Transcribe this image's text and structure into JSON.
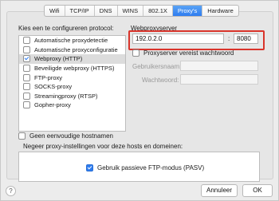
{
  "tabs": [
    "Wifi",
    "TCP/IP",
    "DNS",
    "WINS",
    "802.1X",
    "Proxy's",
    "Hardware"
  ],
  "active_tab": "Proxy's",
  "protocol_section_label": "Kies een te configureren protocol:",
  "protocols": [
    {
      "label": "Automatische proxydetectie",
      "checked": false,
      "selected": false
    },
    {
      "label": "Automatische proxyconfiguratie",
      "checked": false,
      "selected": false
    },
    {
      "label": "Webproxy (HTTP)",
      "checked": true,
      "selected": true
    },
    {
      "label": "Beveiligde webproxy (HTTPS)",
      "checked": false,
      "selected": false
    },
    {
      "label": "FTP-proxy",
      "checked": false,
      "selected": false
    },
    {
      "label": "SOCKS-proxy",
      "checked": false,
      "selected": false
    },
    {
      "label": "Streamingproxy (RTSP)",
      "checked": false,
      "selected": false
    },
    {
      "label": "Gopher-proxy",
      "checked": false,
      "selected": false
    }
  ],
  "server": {
    "label": "Webproxyserver",
    "address": "192.0.2.0",
    "separator": ":",
    "port": "8080",
    "password_required_label": "Proxyserver vereist wachtwoord",
    "username_label": "Gebruikersnaam:",
    "password_label": "Wachtwoord:"
  },
  "simple_hostnames_label": "Geen eenvoudige hostnamen",
  "bypass_label": "Negeer proxy-instellingen voor deze hosts en domeinen:",
  "passive_ftp_label": "Gebruik passieve FTP-modus (PASV)",
  "buttons": {
    "help": "?",
    "cancel": "Annuleer",
    "ok": "OK"
  },
  "colors": {
    "accent": "#2e7cf0",
    "highlight_border": "#d9342b"
  }
}
